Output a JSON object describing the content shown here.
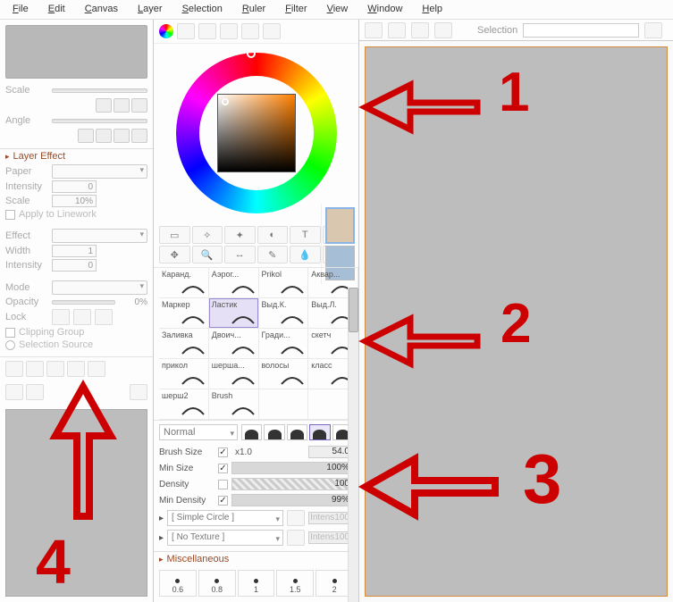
{
  "menu": [
    "File",
    "Edit",
    "Canvas",
    "Layer",
    "Selection",
    "Ruler",
    "Filter",
    "View",
    "Window",
    "Help"
  ],
  "left": {
    "scale_label": "Scale",
    "angle_label": "Angle",
    "layereffect_hdr": "Layer Effect",
    "paper": "Paper",
    "intensity": "Intensity",
    "intensity_val": "0",
    "scale2": "Scale",
    "scale2_val": "10%",
    "apply": "Apply to Linework",
    "effect": "Effect",
    "width": "Width",
    "width_val": "1",
    "intensity2": "Intensity",
    "intensity2_val": "0",
    "mode": "Mode",
    "opacity": "Opacity",
    "opacity_val": "0%",
    "lock": "Lock",
    "clipping": "Clipping Group",
    "selsrc": "Selection Source"
  },
  "tools_top": [
    "◯",
    "≡",
    "≣",
    "▦",
    "◧",
    "⬚"
  ],
  "tool_icons": [
    "▭",
    "✧",
    "✦",
    "◐",
    "T",
    "✥",
    "🔍",
    "↔",
    "✎",
    "💧"
  ],
  "brushes": [
    {
      "name": "Каранд."
    },
    {
      "name": "Аэрог..."
    },
    {
      "name": "Prikol"
    },
    {
      "name": "Аквар..."
    },
    {
      "name": "Маркер"
    },
    {
      "name": "Ластик",
      "sel": true
    },
    {
      "name": "Выд.К."
    },
    {
      "name": "Выд.Л."
    },
    {
      "name": "Заливка"
    },
    {
      "name": "Двоич..."
    },
    {
      "name": "Гради..."
    },
    {
      "name": "скетч"
    },
    {
      "name": "прикол"
    },
    {
      "name": "шерша..."
    },
    {
      "name": "волосы"
    },
    {
      "name": "класс"
    },
    {
      "name": "шерш2"
    },
    {
      "name": "Brush"
    }
  ],
  "blend": "Normal",
  "bs": {
    "size_l": "Brush Size",
    "size_mult": "x1.0",
    "size_v": "54.0",
    "minsize_l": "Min Size",
    "minsize_v": "100%",
    "density_l": "Density",
    "density_v": "100",
    "mindensity_l": "Min Density",
    "mindensity_v": "99%",
    "shape": "[ Simple Circle ]",
    "shape_int": "100",
    "texture": "[ No Texture ]",
    "texture_int": "100",
    "intens": "Intens"
  },
  "misc_hdr": "Miscellaneous",
  "spacing": [
    "0.6",
    "0.8",
    "1",
    "1.5",
    "2"
  ],
  "top_selection": "Selection",
  "anno": {
    "n1": "1",
    "n2": "2",
    "n3": "3",
    "n4": "4"
  }
}
